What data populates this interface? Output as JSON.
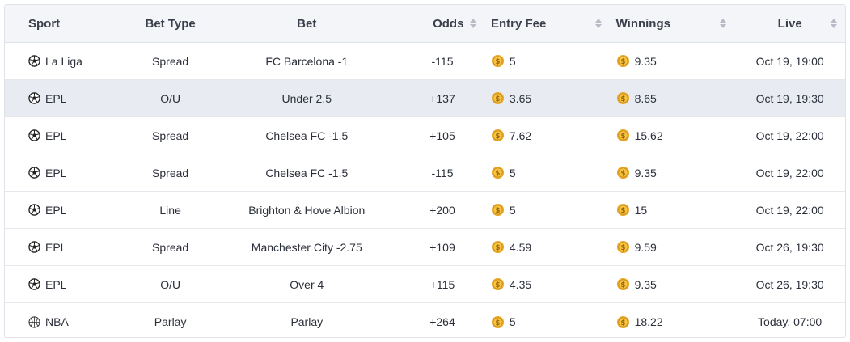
{
  "header": {
    "sport": "Sport",
    "bet_type": "Bet Type",
    "bet": "Bet",
    "odds": "Odds",
    "entry_fee": "Entry Fee",
    "winnings": "Winnings",
    "live": "Live"
  },
  "rows": [
    {
      "sport": "La Liga",
      "sport_icon": "soccer-ball-icon",
      "bet_type": "Spread",
      "bet": "FC Barcelona -1",
      "odds": "-115",
      "entry_fee": "5",
      "winnings": "9.35",
      "live": "Oct 19, 19:00",
      "selected": false
    },
    {
      "sport": "EPL",
      "sport_icon": "soccer-ball-icon",
      "bet_type": "O/U",
      "bet": "Under 2.5",
      "odds": "+137",
      "entry_fee": "3.65",
      "winnings": "8.65",
      "live": "Oct 19, 19:30",
      "selected": true
    },
    {
      "sport": "EPL",
      "sport_icon": "soccer-ball-icon",
      "bet_type": "Spread",
      "bet": "Chelsea FC -1.5",
      "odds": "+105",
      "entry_fee": "7.62",
      "winnings": "15.62",
      "live": "Oct 19, 22:00",
      "selected": false
    },
    {
      "sport": "EPL",
      "sport_icon": "soccer-ball-icon",
      "bet_type": "Spread",
      "bet": "Chelsea FC -1.5",
      "odds": "-115",
      "entry_fee": "5",
      "winnings": "9.35",
      "live": "Oct 19, 22:00",
      "selected": false
    },
    {
      "sport": "EPL",
      "sport_icon": "soccer-ball-icon",
      "bet_type": "Line",
      "bet": "Brighton & Hove Albion",
      "odds": "+200",
      "entry_fee": "5",
      "winnings": "15",
      "live": "Oct 19, 22:00",
      "selected": false
    },
    {
      "sport": "EPL",
      "sport_icon": "soccer-ball-icon",
      "bet_type": "Spread",
      "bet": "Manchester City -2.75",
      "odds": "+109",
      "entry_fee": "4.59",
      "winnings": "9.59",
      "live": "Oct 26, 19:30",
      "selected": false
    },
    {
      "sport": "EPL",
      "sport_icon": "soccer-ball-icon",
      "bet_type": "O/U",
      "bet": "Over 4",
      "odds": "+115",
      "entry_fee": "4.35",
      "winnings": "9.35",
      "live": "Oct 26, 19:30",
      "selected": false
    },
    {
      "sport": "NBA",
      "sport_icon": "basketball-icon",
      "bet_type": "Parlay",
      "bet": "Parlay",
      "odds": "+264",
      "entry_fee": "5",
      "winnings": "18.22",
      "live": "Today, 07:00",
      "selected": false
    }
  ],
  "icons": {
    "currency": "coin-icon",
    "sort": "sort-arrows-icon"
  },
  "colors": {
    "header_bg": "#f4f5f9",
    "selected_row": "#e8ebf2",
    "coin": "#e8a92c",
    "border": "#dfe2e8"
  }
}
